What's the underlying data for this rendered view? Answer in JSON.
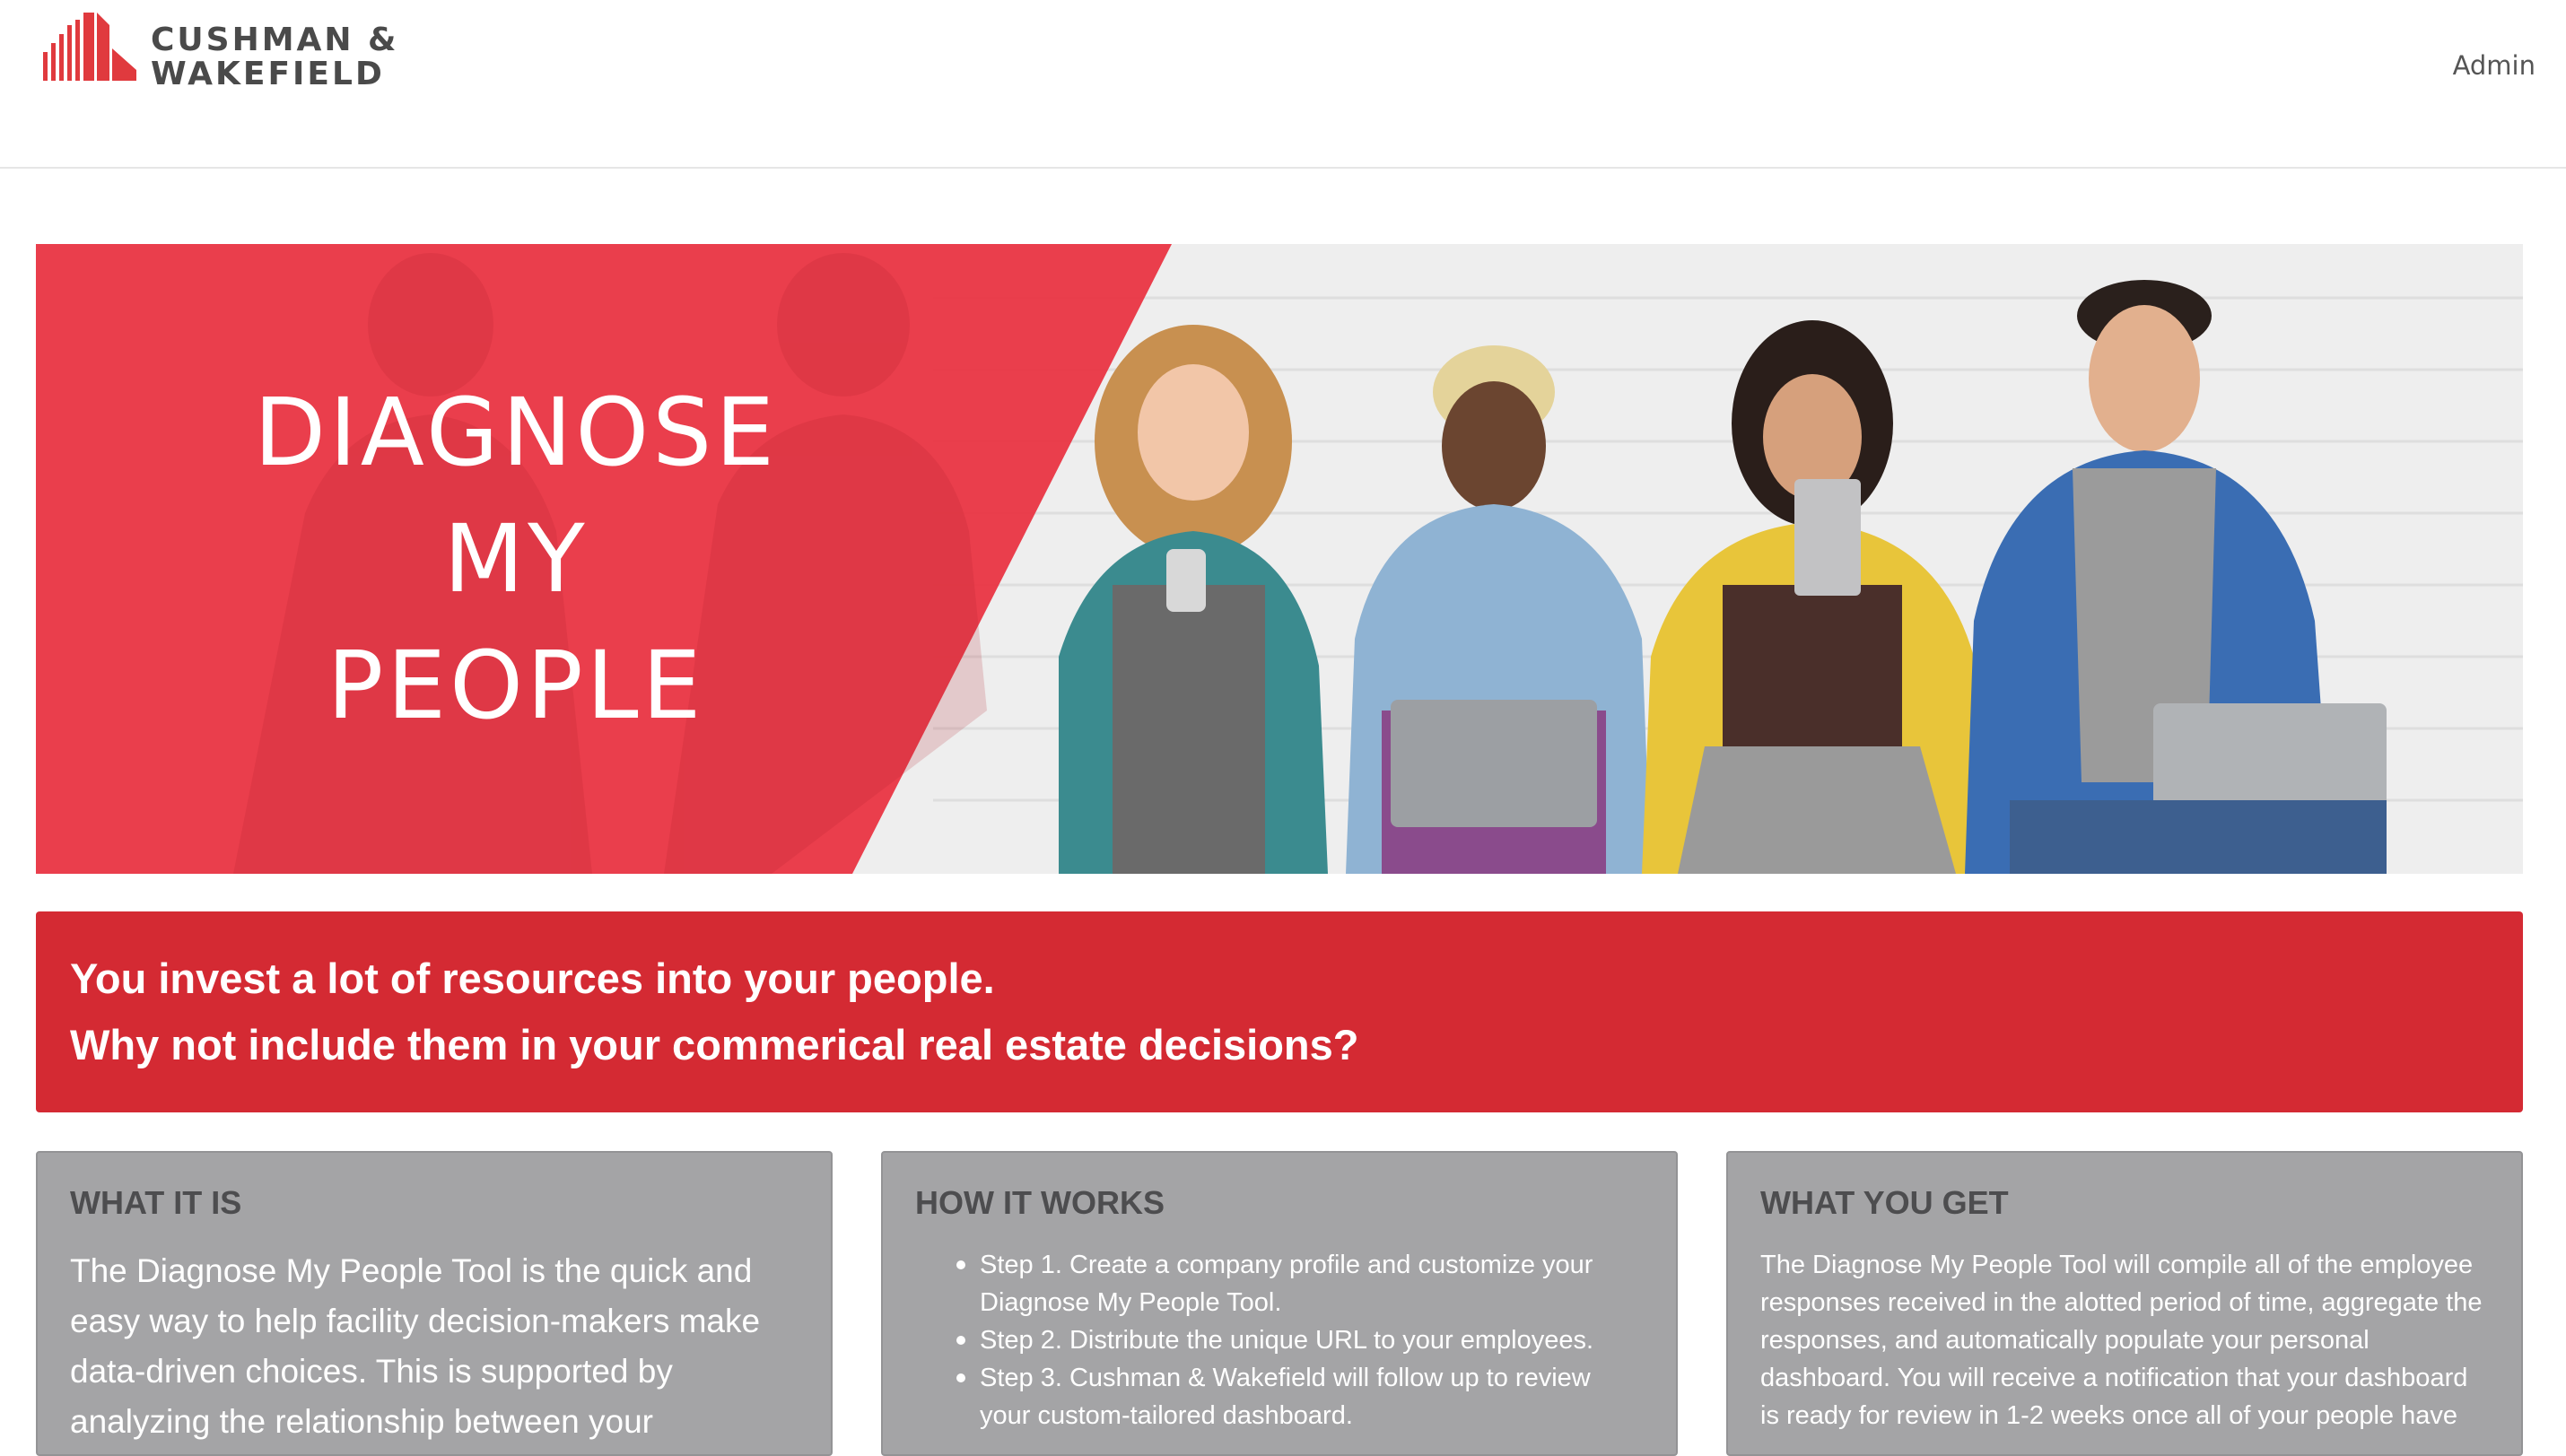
{
  "brand": {
    "line1": "CUSHMAN &",
    "line2": "WAKEFIELD",
    "color": "#e03a3e"
  },
  "nav": {
    "admin_label": "Admin"
  },
  "hero": {
    "title_lines": [
      "DIAGNOSE",
      "MY",
      "PEOPLE"
    ],
    "accent_color": "#e9303f"
  },
  "tagline": {
    "line1": "You invest a lot of resources into your people.",
    "line2": "Why not include them in your commerical real estate decisions?",
    "background": "#d42a33"
  },
  "cards": [
    {
      "title": "WHAT IT IS",
      "text": "The Diagnose My People Tool is the quick and easy way to help facility decision-makers make data-driven choices. This is supported by analyzing the relationship between your"
    },
    {
      "title": "HOW IT WORKS",
      "steps": [
        "Step 1. Create a company profile and customize your Diagnose My People Tool.",
        "Step 2. Distribute the unique URL to your employees.",
        "Step 3. Cushman & Wakefield will follow up to review your custom-tailored dashboard."
      ]
    },
    {
      "title": "WHAT YOU GET",
      "text": "The Diagnose My People Tool will compile all of the employee responses received in the alotted period of time, aggregate the responses, and automatically populate your personal dashboard. You will receive a notification that your dashboard is ready for review in 1-2 weeks once all of your people have"
    }
  ]
}
